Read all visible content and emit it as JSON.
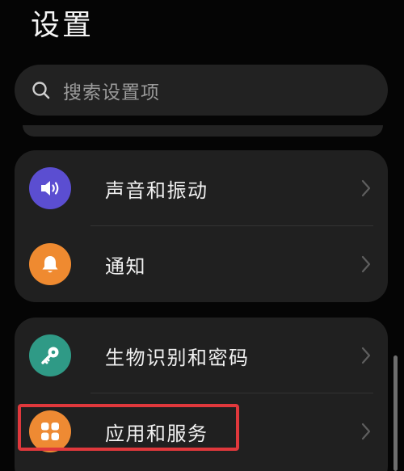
{
  "header": {
    "title": "设置"
  },
  "search": {
    "placeholder": "搜索设置项",
    "icon": "search-icon"
  },
  "groups": [
    {
      "items": [
        {
          "label": "声音和振动",
          "icon": "speaker-icon",
          "color": "#5b4ed1"
        },
        {
          "label": "通知",
          "icon": "bell-icon",
          "color": "#ef8a30"
        }
      ]
    },
    {
      "items": [
        {
          "label": "生物识别和密码",
          "icon": "key-icon",
          "color": "#2f9a86"
        },
        {
          "label": "应用和服务",
          "icon": "apps-grid-icon",
          "color": "#ee8a33",
          "highlighted": true
        }
      ]
    }
  ],
  "colors": {
    "background": "#050505",
    "card": "#202020",
    "highlight_border": "#e0383c"
  }
}
